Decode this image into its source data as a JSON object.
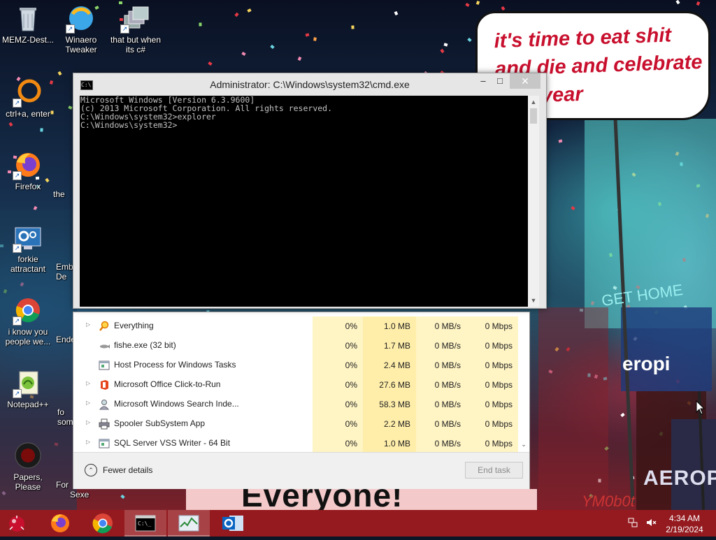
{
  "wallpaper": {
    "bubble_text": "it's time to eat shit and die and celebrate new year",
    "sign_bottom": "Everyone!",
    "sign_europe": "eropi",
    "sign_aeropostale": "AEROPOS",
    "sign_gethome": "GET HOME",
    "sign_ymobot": "YM0b0t"
  },
  "desktop_icons": [
    {
      "id": "memz",
      "label": "MEMZ-Dest...",
      "icon": "recycle-bin-icon"
    },
    {
      "id": "winaero",
      "label": "Winaero Tweaker",
      "icon": "winaero-icon"
    },
    {
      "id": "csharp",
      "label": "that but when its c#",
      "icon": "stacked-windows-icon"
    },
    {
      "id": "ctrla",
      "label": "ctrl+a, enter",
      "icon": "orange-ring-icon"
    },
    {
      "id": "firefox",
      "label": "Firefox",
      "icon": "firefox-icon"
    },
    {
      "id": "forkie",
      "label": "forkie attractant",
      "icon": "settings-monitor-icon"
    },
    {
      "id": "chrome",
      "label": "i know you people we...",
      "icon": "chrome-icon"
    },
    {
      "id": "notepadpp",
      "label": "Notepad++",
      "icon": "notepadpp-icon"
    },
    {
      "id": "papers",
      "label": "Papers, Please",
      "icon": "papers-please-icon"
    }
  ],
  "partial_icon_labels": [
    "the",
    "Emb De",
    "Ende",
    "fo som",
    "For",
    "Sexe"
  ],
  "cmd": {
    "title": "Administrator: C:\\Windows\\system32\\cmd.exe",
    "lines": [
      "Microsoft Windows [Version 6.3.9600]",
      "(c) 2013 Microsoft Corporation. All rights reserved.",
      "",
      "C:\\Windows\\system32>explorer",
      "",
      "C:\\Windows\\system32>"
    ],
    "minimize": "–",
    "maximize": "□",
    "close": "✕"
  },
  "task_manager": {
    "rows": [
      {
        "name": "Everything",
        "expand": true,
        "icon": "magnifier-icon",
        "cpu": "0%",
        "memory": "1.0 MB",
        "disk": "0 MB/s",
        "network": "0 Mbps"
      },
      {
        "name": "fishe.exe (32 bit)",
        "expand": false,
        "icon": "fish-icon",
        "cpu": "0%",
        "memory": "1.7 MB",
        "disk": "0 MB/s",
        "network": "0 Mbps"
      },
      {
        "name": "Host Process for Windows Tasks",
        "expand": false,
        "icon": "window-process-icon",
        "cpu": "0%",
        "memory": "2.4 MB",
        "disk": "0 MB/s",
        "network": "0 Mbps"
      },
      {
        "name": "Microsoft Office Click-to-Run",
        "expand": true,
        "icon": "office-icon",
        "cpu": "0%",
        "memory": "27.6 MB",
        "disk": "0 MB/s",
        "network": "0 Mbps"
      },
      {
        "name": "Microsoft Windows Search Inde...",
        "expand": true,
        "icon": "search-indexer-icon",
        "cpu": "0%",
        "memory": "58.3 MB",
        "disk": "0 MB/s",
        "network": "0 Mbps"
      },
      {
        "name": "Spooler SubSystem App",
        "expand": true,
        "icon": "printer-icon",
        "cpu": "0%",
        "memory": "2.2 MB",
        "disk": "0 MB/s",
        "network": "0 Mbps"
      },
      {
        "name": "SQL Server VSS Writer - 64 Bit",
        "expand": true,
        "icon": "window-process-icon",
        "cpu": "0%",
        "memory": "1.0 MB",
        "disk": "0 MB/s",
        "network": "0 Mbps"
      }
    ],
    "fewer_details": "Fewer details",
    "end_task": "End task"
  },
  "taskbar": {
    "apps": [
      "firefox",
      "chrome",
      "cmd",
      "task-manager",
      "outlook"
    ],
    "time": "4:34 AM",
    "date": "2/19/2024"
  },
  "colors": {
    "taskbar": "#941a1f",
    "cmd_bg": "#000000",
    "heat_cell": "#fff4c4"
  }
}
